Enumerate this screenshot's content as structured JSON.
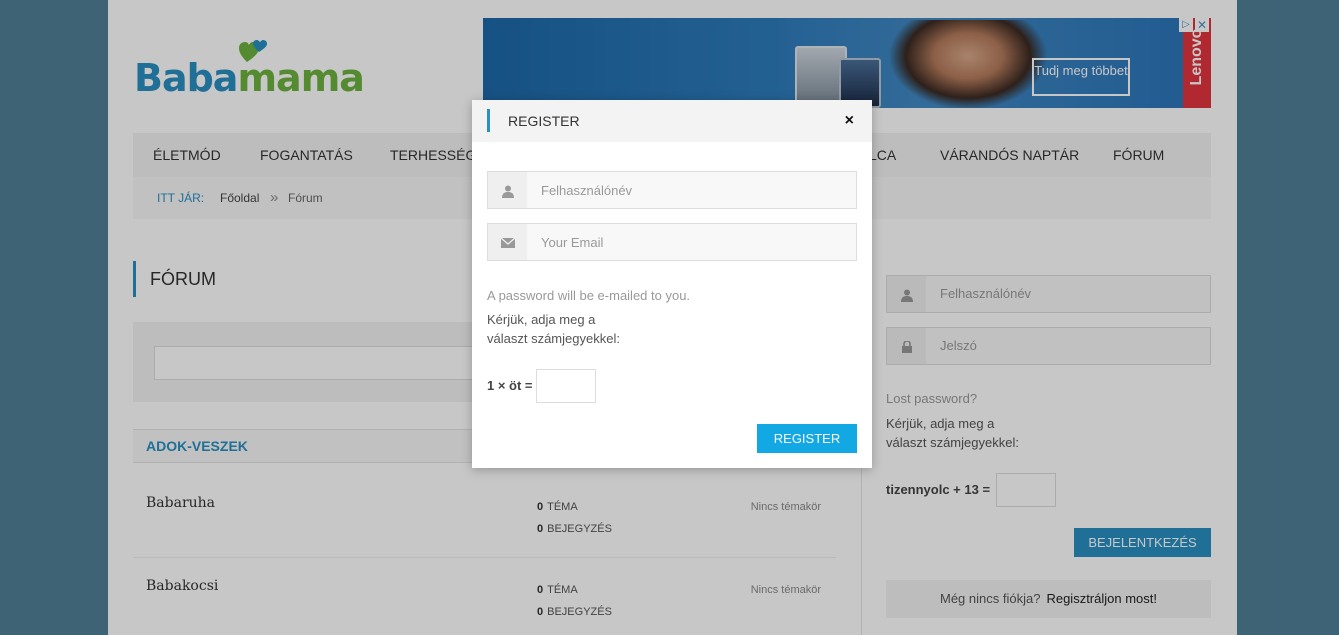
{
  "logo": {
    "part1": "Baba",
    "part2": "mama"
  },
  "ad": {
    "cta": "Tudj meg többet",
    "brand": "Lenovo",
    "close_glyph": "✕",
    "info_glyph": "▷"
  },
  "nav": {
    "items": [
      {
        "label": "ÉLETMÓD"
      },
      {
        "label": "FOGANTATÁS"
      },
      {
        "label": "TERHESSÉG"
      },
      {
        "label": "LCA"
      },
      {
        "label": "VÁRANDÓS NAPTÁR"
      },
      {
        "label": "FÓRUM"
      }
    ]
  },
  "breadcrumb": {
    "label": "ITT JÁR:",
    "home": "Főoldal",
    "separator": "»",
    "current": "Fórum"
  },
  "forum": {
    "title": "FÓRUM",
    "category": "ADOK-VESZEK",
    "rows": [
      {
        "name": "Babaruha",
        "topics_count": "0",
        "topics_label": "TÉMA",
        "posts_count": "0",
        "posts_label": "BEJEGYZÉS",
        "last": "Nincs témakör"
      },
      {
        "name": "Babakocsi",
        "topics_count": "0",
        "topics_label": "TÉMA",
        "posts_count": "0",
        "posts_label": "BEJEGYZÉS",
        "last": "Nincs témakör"
      }
    ]
  },
  "sidebar": {
    "username_placeholder": "Felhasználónév",
    "password_placeholder": "Jelszó",
    "lost_password": "Lost password?",
    "captcha_help_1": "Kérjük, adja meg a",
    "captcha_help_2": "választ számjegyekkel:",
    "captcha_question": "tizennyolc + 13 =",
    "login_button": "BEJELENTKEZÉS",
    "no_account": "Még nincs fiókja?",
    "register_link": "Regisztráljon most!"
  },
  "modal": {
    "title": "REGISTER",
    "close": "×",
    "username_placeholder": "Felhasználónév",
    "email_placeholder": "Your Email",
    "info": "A password will be e-mailed to you.",
    "captcha_help_1": "Kérjük, adja meg a",
    "captcha_help_2": "választ számjegyekkel:",
    "captcha_question": "1 × öt =",
    "register_button": "REGISTER"
  },
  "colors": {
    "accent": "#2a8fc2",
    "logo_green": "#6cb33f",
    "button_blue": "#11a8e4",
    "brand_red": "#e2343e"
  }
}
